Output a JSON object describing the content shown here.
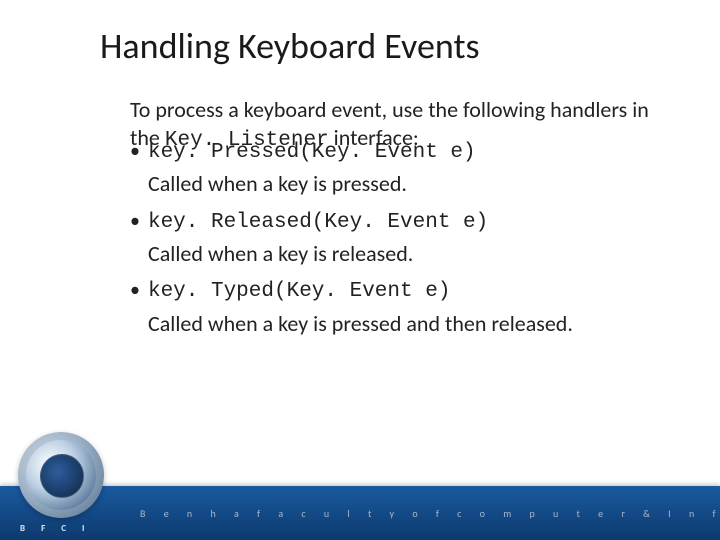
{
  "title": "Handling Keyboard Events",
  "intro": {
    "prefix": "To process a keyboard event, use the following handlers in the ",
    "code": "Key. Listener",
    "suffix": " interface:"
  },
  "items": [
    {
      "code": "key. Pressed(Key. Event e)",
      "desc": "Called when a key is pressed."
    },
    {
      "code": "key. Released(Key. Event e)",
      "desc": "Called when a key is released."
    },
    {
      "code": "key. Typed(Key. Event e)",
      "desc": "Called when a key is pressed and then released."
    }
  ],
  "footer": {
    "org_short": "B F C I",
    "org_long": "B e n h a   f a c u l t y   o f   c o m p u t e r   &   I n f o r m a t i c s"
  }
}
